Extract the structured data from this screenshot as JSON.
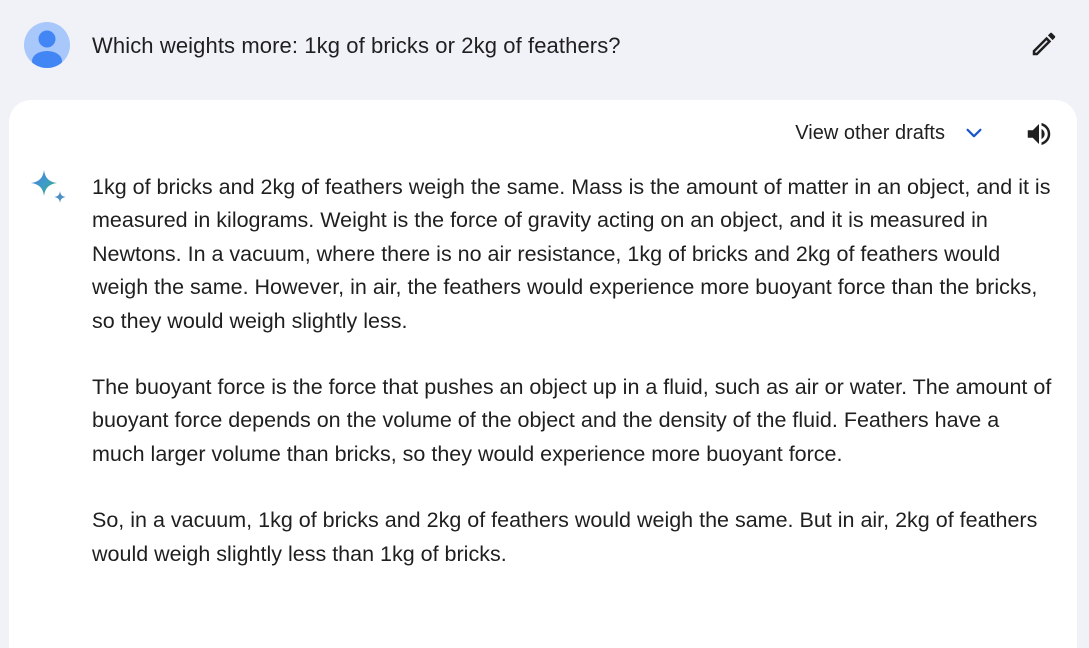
{
  "prompt": {
    "text": "Which weights more: 1kg of bricks or 2kg of feathers?",
    "avatar_icon": "user-avatar-icon",
    "edit_icon": "pencil-icon"
  },
  "response": {
    "view_drafts_label": "View other drafts",
    "drafts_icon": "chevron-down-icon",
    "speaker_icon": "speaker-icon",
    "assistant_icon": "sparkle-icon",
    "paragraphs": [
      "1kg of bricks and 2kg of feathers weigh the same. Mass is the amount of matter in an object, and it is measured in kilograms. Weight is the force of gravity acting on an object, and it is measured in Newtons. In a vacuum, where there is no air resistance, 1kg of bricks and 2kg of feathers would weigh the same. However, in air, the feathers would experience more buoyant force than the bricks, so they would weigh slightly less.",
      "The buoyant force is the force that pushes an object up in a fluid, such as air or water. The amount of buoyant force depends on the volume of the object and the density of the fluid. Feathers have a much larger volume than bricks, so they would experience more buoyant force.",
      "So, in a vacuum, 1kg of bricks and 2kg of feathers would weigh the same. But in air, 2kg of feathers would weigh slightly less than 1kg of bricks."
    ]
  },
  "colors": {
    "page_background": "#f0f2f8",
    "card_background": "#ffffff",
    "avatar_background": "#a8c7fa",
    "avatar_figure": "#4285f4",
    "chevron": "#1a56c8",
    "text": "#1f1f1f"
  }
}
